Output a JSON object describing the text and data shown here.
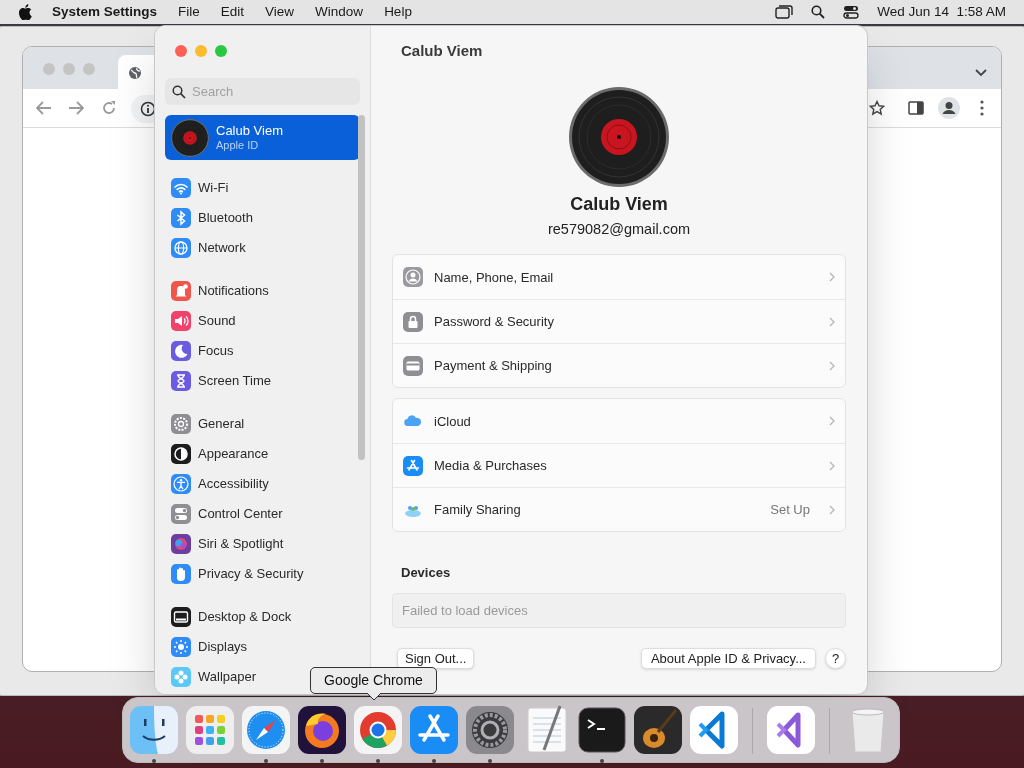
{
  "menubar": {
    "app": "System Settings",
    "menus": [
      "File",
      "Edit",
      "View",
      "Window",
      "Help"
    ],
    "clock": "Wed Jun 14  1:58 AM"
  },
  "settings": {
    "title": "Calub Viem",
    "search": {
      "placeholder": "Search"
    },
    "account": {
      "name": "Calub Viem",
      "subtitle": "Apple ID",
      "selected": true
    },
    "sidebar_groups": [
      [
        {
          "label": "Wi-Fi",
          "kind": "wifi",
          "color": "#2f8cf6",
          "selected": false
        },
        {
          "label": "Bluetooth",
          "kind": "bluetooth",
          "color": "#2f8cf6",
          "selected": false
        },
        {
          "label": "Network",
          "kind": "network",
          "color": "#2f8cf6",
          "selected": false
        }
      ],
      [
        {
          "label": "Notifications",
          "kind": "notifications",
          "color": "#f0564b",
          "selected": false
        },
        {
          "label": "Sound",
          "kind": "sound",
          "color": "#f0426a",
          "selected": false
        },
        {
          "label": "Focus",
          "kind": "focus",
          "color": "#6a5ce0",
          "selected": false
        },
        {
          "label": "Screen Time",
          "kind": "screen-time",
          "color": "#6a5ce0",
          "selected": false
        }
      ],
      [
        {
          "label": "General",
          "kind": "general",
          "color": "#8e8e93",
          "selected": false
        },
        {
          "label": "Appearance",
          "kind": "appearance",
          "color": "#1c1c1e",
          "selected": false
        },
        {
          "label": "Accessibility",
          "kind": "accessibility",
          "color": "#2f8cf6",
          "selected": false
        },
        {
          "label": "Control Center",
          "kind": "control-center",
          "color": "#8e8e93",
          "selected": false
        },
        {
          "label": "Siri & Spotlight",
          "kind": "siri",
          "color": "#6b3fa0",
          "selected": false
        },
        {
          "label": "Privacy & Security",
          "kind": "privacy",
          "color": "#2f8cf6",
          "selected": false
        }
      ],
      [
        {
          "label": "Desktop & Dock",
          "kind": "desktop-dock",
          "color": "#1c1c1e",
          "selected": false
        },
        {
          "label": "Displays",
          "kind": "displays",
          "color": "#2f8cf6",
          "selected": false
        },
        {
          "label": "Wallpaper",
          "kind": "wallpaper",
          "color": "#5ac8fa",
          "selected": false
        }
      ]
    ],
    "profile": {
      "name": "Calub Viem",
      "email": "re579082@gmail.com"
    },
    "row_groups": [
      [
        {
          "label": "Name, Phone, Email",
          "kind": "contact"
        },
        {
          "label": "Password & Security",
          "kind": "lock"
        },
        {
          "label": "Payment & Shipping",
          "kind": "card"
        }
      ],
      [
        {
          "label": "iCloud",
          "kind": "cloud"
        },
        {
          "label": "Media & Purchases",
          "kind": "store"
        },
        {
          "label": "Family Sharing",
          "kind": "family",
          "detail": "Set Up"
        }
      ]
    ],
    "devices": {
      "heading": "Devices",
      "message": "Failed to load devices"
    },
    "buttons": {
      "sign_out": "Sign Out...",
      "about": "About Apple ID & Privacy...",
      "help": "?"
    }
  },
  "tooltip": "Google Chrome",
  "dock": [
    {
      "kind": "finder",
      "running": true
    },
    {
      "kind": "launchpad",
      "running": false
    },
    {
      "kind": "safari",
      "running": true
    },
    {
      "kind": "firefox",
      "running": true
    },
    {
      "kind": "chrome",
      "running": true
    },
    {
      "kind": "appstore",
      "running": true
    },
    {
      "kind": "settings",
      "running": true
    },
    {
      "kind": "textedit",
      "running": false
    },
    {
      "kind": "terminal",
      "running": true
    },
    {
      "kind": "guitar",
      "running": false
    },
    {
      "kind": "vscode",
      "running": false
    },
    {
      "kind": "separator"
    },
    {
      "kind": "visualstudio",
      "running": false
    },
    {
      "kind": "separator"
    },
    {
      "kind": "trash",
      "running": false
    }
  ]
}
